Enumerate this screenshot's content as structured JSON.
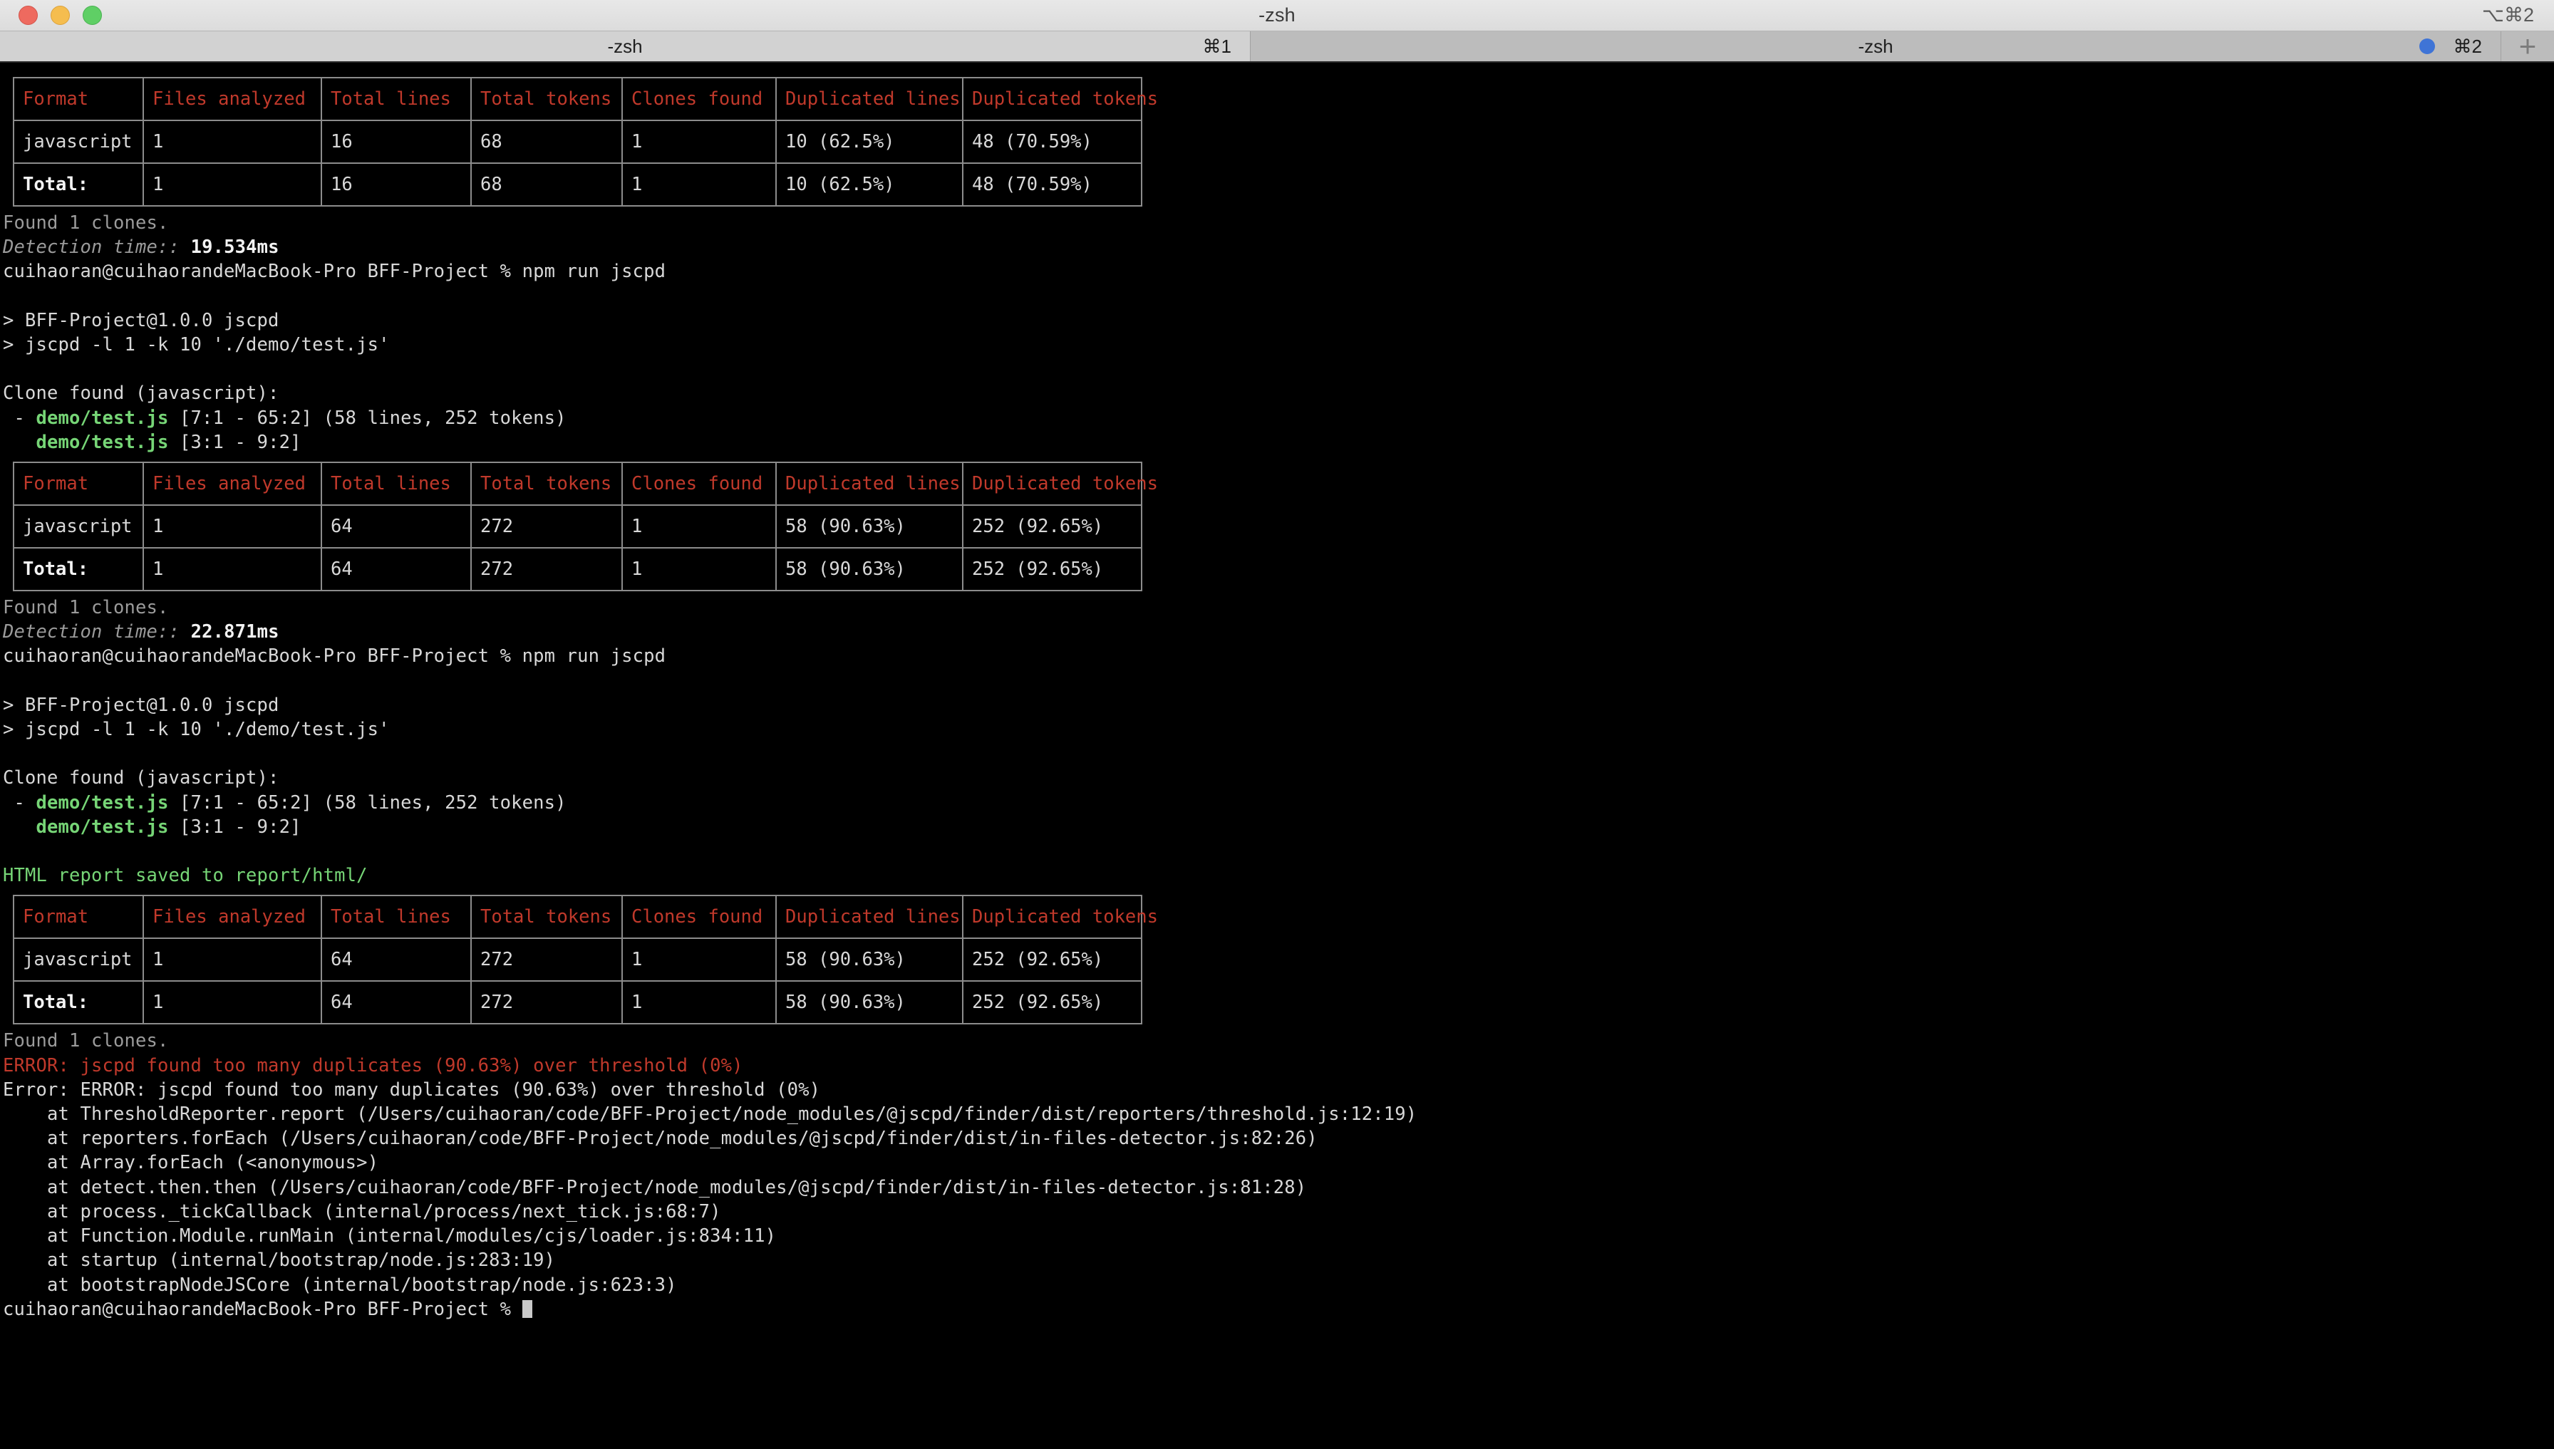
{
  "window": {
    "title": "-zsh",
    "title_shortcut": "⌥⌘2",
    "traffic_lights": [
      "close",
      "minimize",
      "zoom"
    ]
  },
  "tabs": [
    {
      "label": "-zsh",
      "shortcut": "⌘1",
      "active": true,
      "has_dot": false
    },
    {
      "label": "-zsh",
      "shortcut": "⌘2",
      "active": false,
      "has_dot": true
    }
  ],
  "new_tab_label": "+",
  "colors": {
    "background": "#000000",
    "foreground": "#d8d8d8",
    "dim": "#9b9b9b",
    "red": "#c0392b",
    "green": "#76d576",
    "table_border": "#8c8c8c",
    "tab_dot": "#3f74d6"
  },
  "table_headers": [
    "Format",
    "Files analyzed",
    "Total lines",
    "Total tokens",
    "Clones found",
    "Duplicated lines",
    "Duplicated tokens"
  ],
  "tables": [
    {
      "id": "table-1",
      "rows": [
        {
          "cells": [
            "javascript",
            "1",
            "16",
            "68",
            "1",
            "10 (62.5%)",
            "48 (70.59%)"
          ],
          "total": false
        },
        {
          "cells": [
            "Total:",
            "1",
            "16",
            "68",
            "1",
            "10 (62.5%)",
            "48 (70.59%)"
          ],
          "total": true
        }
      ]
    },
    {
      "id": "table-2",
      "rows": [
        {
          "cells": [
            "javascript",
            "1",
            "64",
            "272",
            "1",
            "58 (90.63%)",
            "252 (92.65%)"
          ],
          "total": false
        },
        {
          "cells": [
            "Total:",
            "1",
            "64",
            "272",
            "1",
            "58 (90.63%)",
            "252 (92.65%)"
          ],
          "total": true
        }
      ]
    },
    {
      "id": "table-3",
      "rows": [
        {
          "cells": [
            "javascript",
            "1",
            "64",
            "272",
            "1",
            "58 (90.63%)",
            "252 (92.65%)"
          ],
          "total": false
        },
        {
          "cells": [
            "Total:",
            "1",
            "64",
            "272",
            "1",
            "58 (90.63%)",
            "252 (92.65%)"
          ],
          "total": true
        }
      ]
    }
  ],
  "block1": {
    "found_clones": "Found 1 clones.",
    "detection_label": "Detection time::",
    "detection_value": "19.534ms",
    "prompt": "cuihaoran@cuihaorandeMacBook-Pro BFF-Project % ",
    "command": "npm run jscpd"
  },
  "run1": {
    "pkg_line": "> BFF-Project@1.0.0 jscpd",
    "cmd_line": "> jscpd -l 1 -k 10 './demo/test.js'",
    "clone_header": "Clone found (javascript):",
    "clone_a_prefix": " - ",
    "clone_a_file": "demo/test.js",
    "clone_a_rest": " [7:1 - 65:2] (58 lines, 252 tokens)",
    "clone_b_prefix": "   ",
    "clone_b_file": "demo/test.js",
    "clone_b_rest": " [3:1 - 9:2]"
  },
  "block2": {
    "found_clones": "Found 1 clones.",
    "detection_label": "Detection time::",
    "detection_value": "22.871ms",
    "prompt": "cuihaoran@cuihaorandeMacBook-Pro BFF-Project % ",
    "command": "npm run jscpd"
  },
  "run2": {
    "pkg_line": "> BFF-Project@1.0.0 jscpd",
    "cmd_line": "> jscpd -l 1 -k 10 './demo/test.js'",
    "clone_header": "Clone found (javascript):",
    "clone_a_prefix": " - ",
    "clone_a_file": "demo/test.js",
    "clone_a_rest": " [7:1 - 65:2] (58 lines, 252 tokens)",
    "clone_b_prefix": "   ",
    "clone_b_file": "demo/test.js",
    "clone_b_rest": " [3:1 - 9:2]",
    "html_report": "HTML report saved to report/html/"
  },
  "block3": {
    "found_clones": "Found 1 clones.",
    "error_red": "ERROR: jscpd found too many duplicates (90.63%) over threshold (0%)",
    "error_white": "Error: ERROR: jscpd found too many duplicates (90.63%) over threshold (0%)",
    "stack": [
      "    at ThresholdReporter.report (/Users/cuihaoran/code/BFF-Project/node_modules/@jscpd/finder/dist/reporters/threshold.js:12:19)",
      "    at reporters.forEach (/Users/cuihaoran/code/BFF-Project/node_modules/@jscpd/finder/dist/in-files-detector.js:82:26)",
      "    at Array.forEach (<anonymous>)",
      "    at detect.then.then (/Users/cuihaoran/code/BFF-Project/node_modules/@jscpd/finder/dist/in-files-detector.js:81:28)",
      "    at process._tickCallback (internal/process/next_tick.js:68:7)",
      "    at Function.Module.runMain (internal/modules/cjs/loader.js:834:11)",
      "    at startup (internal/bootstrap/node.js:283:19)",
      "    at bootstrapNodeJSCore (internal/bootstrap/node.js:623:3)"
    ],
    "final_prompt": "cuihaoran@cuihaorandeMacBook-Pro BFF-Project % "
  }
}
